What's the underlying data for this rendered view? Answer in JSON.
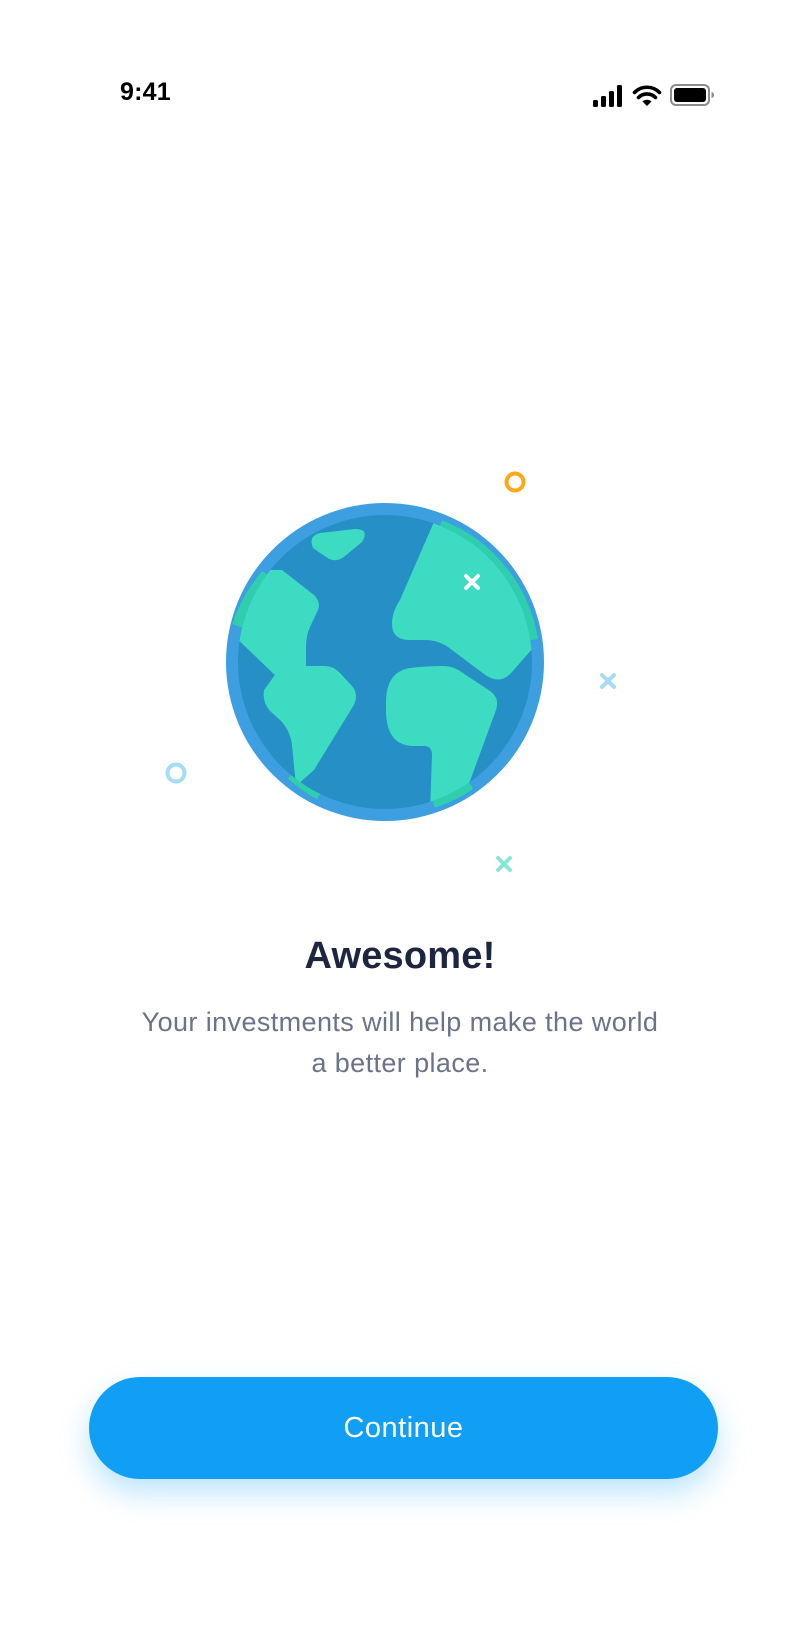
{
  "status_bar": {
    "time": "9:41",
    "icons": [
      "cellular-signal-icon",
      "wifi-icon",
      "battery-icon"
    ]
  },
  "illustration": {
    "icon": "globe-icon",
    "decorations": [
      "orange-ring-icon",
      "blue-ring-icon",
      "light-blue-cross-icon",
      "teal-cross-icon",
      "white-cross-icon"
    ]
  },
  "content": {
    "title": "Awesome!",
    "subtitle": "Your investments will help make the world a better place."
  },
  "actions": {
    "continue_label": "Continue"
  },
  "colors": {
    "primary": "#109ff5",
    "globe_ocean": "#258fc6",
    "globe_rim": "#3d9fe0",
    "globe_land": "#3ddcc2",
    "accent_orange": "#ffa917",
    "title_text": "#1e2540",
    "body_text": "#6b7289"
  }
}
